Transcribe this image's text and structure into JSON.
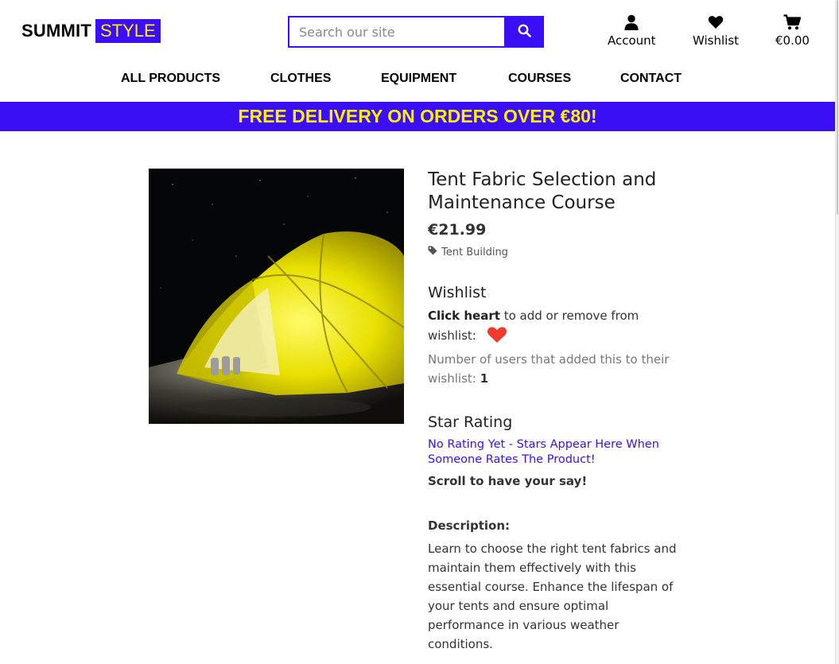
{
  "brand": {
    "part1": "SUMMIT",
    "part2": "STYLE",
    "accent": "#3a0ff6",
    "highlight": "#ffef00"
  },
  "search": {
    "placeholder": "Search our site",
    "value": "",
    "icon": "search-icon"
  },
  "header": {
    "account": {
      "label": "Account",
      "icon": "user-icon"
    },
    "wishlist": {
      "label": "Wishlist",
      "icon": "heart-icon"
    },
    "cart": {
      "label": "€0.00",
      "icon": "shopping-cart-icon"
    }
  },
  "nav": {
    "items": [
      {
        "label": "ALL PRODUCTS"
      },
      {
        "label": "CLOTHES"
      },
      {
        "label": "EQUIPMENT"
      },
      {
        "label": "COURSES"
      },
      {
        "label": "CONTACT"
      }
    ]
  },
  "banner": {
    "text": "FREE DELIVERY ON ORDERS OVER €80!"
  },
  "product": {
    "title": "Tent Fabric Selection and Maintenance Course",
    "price": "€21.99",
    "tag": "Tent Building",
    "image_alt": "yellow tent lit at night"
  },
  "wishlist": {
    "heading": "Wishlist",
    "click_bold": "Click heart",
    "click_rest": " to add or remove from wishlist:",
    "count_text": "Number of users that added this to their wishlist: ",
    "count": "1",
    "heart_color": "#f03a2e"
  },
  "rating": {
    "heading": "Star Rating",
    "no_rating": "No Rating Yet - Stars Appear Here When Someone Rates The Product!",
    "scroll_prompt": "Scroll to have your say!"
  },
  "description": {
    "label": "Description:",
    "text": "Learn to choose the right tent fabrics and maintain them effectively with this essential course. Enhance the lifespan of your tents and ensure optimal performance in various weather conditions."
  }
}
